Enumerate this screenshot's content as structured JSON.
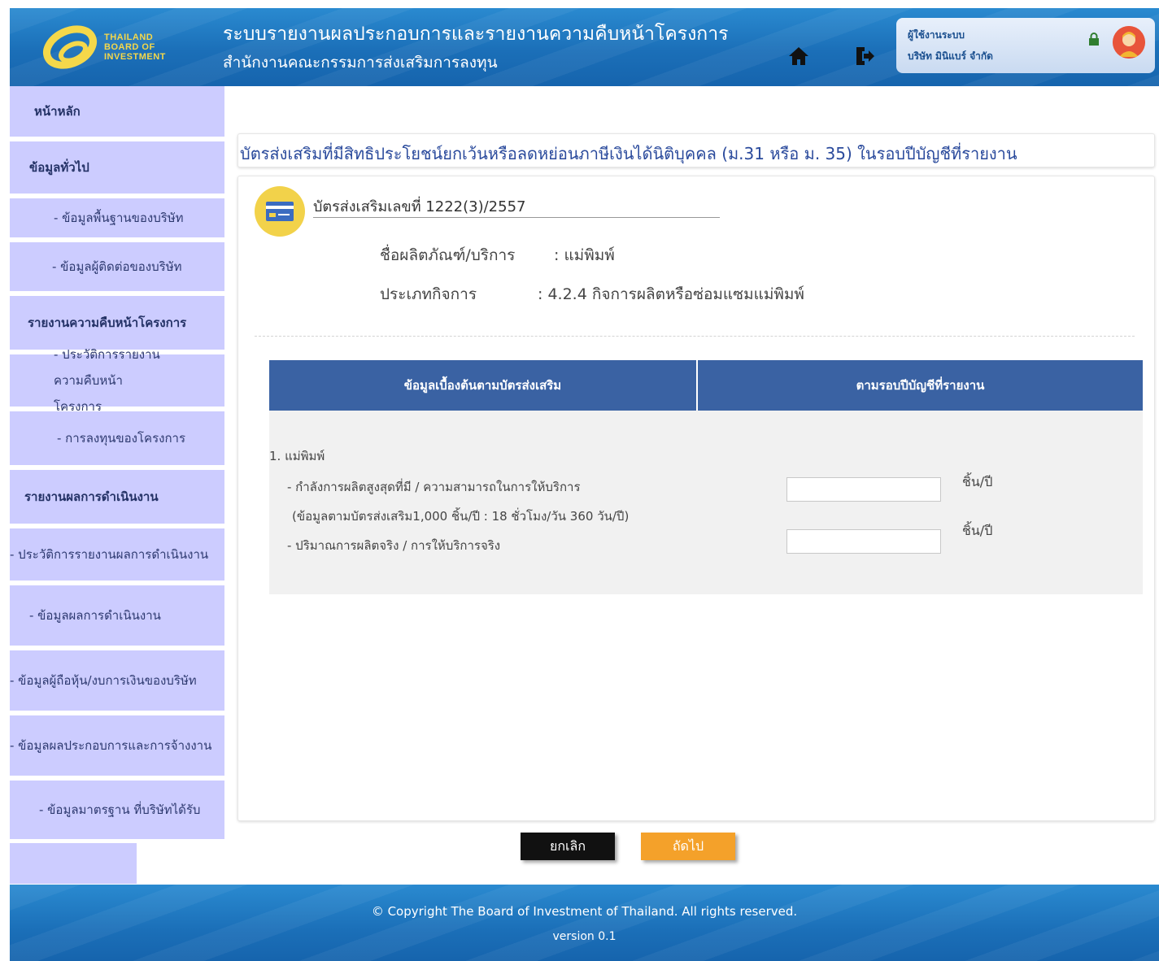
{
  "header": {
    "logo_lines": [
      "THAILAND",
      "BOARD OF",
      "INVESTMENT"
    ],
    "title": "ระบบรายงานผลประกอบการและรายงานความคืบหน้าโครงการ",
    "subtitle": "สำนักงานคณะกรรมการส่งเสริมการลงทุน",
    "user_role": "ผู้ใช้งานระบบ",
    "user_company": "บริษัท มินิแบร์ จำกัด",
    "icons": [
      "home-icon",
      "logout-icon",
      "lock-icon",
      "user-avatar"
    ]
  },
  "sidebar": {
    "items": [
      {
        "label": "หน้าหลัก",
        "type": "head"
      },
      {
        "label": "ข้อมูลทั่วไป",
        "type": "head"
      },
      {
        "label": "- ข้อมูลพื้นฐานของบริษัท",
        "type": "sub"
      },
      {
        "label": "- ข้อมูลผู้ติดต่อของบริษัท",
        "type": "sub"
      },
      {
        "label": "รายงานความคืบหน้าโครงการ",
        "type": "head"
      },
      {
        "label": "- ประวัติการรายงาน ความคืบหน้าโครงการ",
        "type": "sub"
      },
      {
        "label": "- การลงทุนของโครงการ",
        "type": "sub"
      },
      {
        "label": "รายงานผลการดำเนินงาน",
        "type": "head"
      },
      {
        "label": "- ประวัติการรายงานผลการดำเนินงาน",
        "type": "sub"
      },
      {
        "label": "- ข้อมูลผลการดำเนินงาน",
        "type": "sub"
      },
      {
        "label": "- ข้อมูลผู้ถือหุ้น/งบการเงินของบริษัท",
        "type": "sub"
      },
      {
        "label": "- ข้อมูลผลประกอบการและการจ้างงาน",
        "type": "sub"
      },
      {
        "label": "- ข้อมูลมาตรฐาน ที่บริษัทได้รับ",
        "type": "sub"
      }
    ]
  },
  "main": {
    "section_title": "บัตรส่งเสริมที่มีสิทธิประโยชน์ยกเว้นหรือลดหย่อนภาษีเงินได้นิติบุคคล (ม.31 หรือ ม. 35) ในรอบปีบัญชีที่รายงาน",
    "card_number": "บัตรส่งเสริมเลขที่ 1222(3)/2557",
    "product_label": "ชื่อผลิตภัณฑ์/บริการ",
    "product_value": ": แม่พิมพ์",
    "activity_label": "ประเภทกิจการ",
    "activity_value": ": 4.2.4 กิจการผลิตหรือซ่อมแซมแม่พิมพ์",
    "table": {
      "col1": "ข้อมูลเบื้องต้นตามบัตรส่งเสริม",
      "col2": "ตามรอบปีบัญชีที่รายงาน",
      "item_title": "1. แม่พิมพ์",
      "row1_label": "- กำลังการผลิตสูงสุดที่มี / ความสามารถในการให้บริการ",
      "row1_note": "(ข้อมูลตามบัตรส่งเสริม1,000 ชิ้น/ปี : 18 ชั่วโมง/วัน 360 วัน/ปี)",
      "row2_label": "- ปริมาณการผลิตจริง / การให้บริการจริง",
      "unit": "ชิ้น/ปี",
      "row1_value": "",
      "row2_value": ""
    },
    "cancel_label": "ยกเลิก",
    "next_label": "ถัดไป"
  },
  "footer": {
    "copyright": "© Copyright The Board of Investment of Thailand. All rights reserved.",
    "version": "version 0.1"
  },
  "colors": {
    "header_blue": "#1b6fb8",
    "sidebar_lavender": "#ccccff",
    "table_head_blue": "#3a62a3",
    "title_blue": "#2a4a9c",
    "next_orange": "#f4a12a"
  }
}
